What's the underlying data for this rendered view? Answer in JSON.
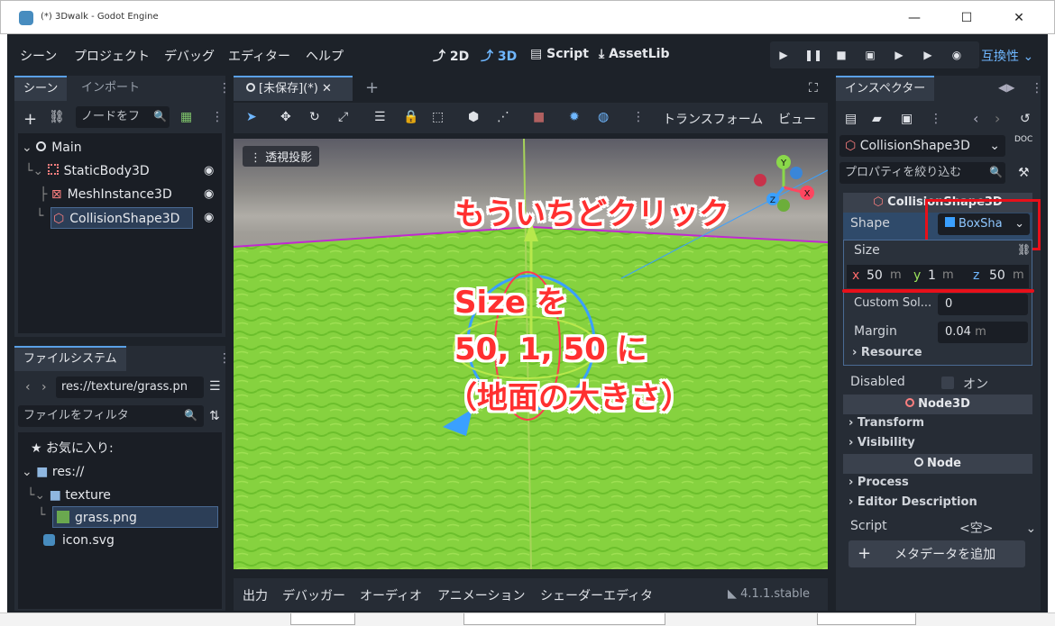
{
  "window": {
    "title": "(*) 3Dwalk - Godot Engine",
    "minimize": "—",
    "maximize": "☐",
    "close": "✕"
  },
  "menu": [
    "シーン",
    "プロジェクト",
    "デバッグ",
    "エディター",
    "ヘルプ"
  ],
  "modes": {
    "m2d": "2D",
    "m3d": "3D",
    "script": "Script",
    "assetlib": "AssetLib"
  },
  "renderer": "互換性",
  "scene_panel": {
    "tabs": [
      "シーン",
      "インポート"
    ],
    "filter_placeholder": "ノードをフ",
    "nodes": [
      "Main",
      "StaticBody3D",
      "MeshInstance3D",
      "CollisionShape3D"
    ]
  },
  "fs_panel": {
    "tab": "ファイルシステム",
    "path": "res://texture/grass.pn",
    "filter_placeholder": "ファイルをフィルタ",
    "items": [
      "お気に入り:",
      "res://",
      "texture",
      "grass.png",
      "icon.svg"
    ]
  },
  "editor": {
    "tab": "[未保存](*)",
    "menu_transform": "トランスフォーム",
    "menu_view": "ビュー",
    "projection": "透視投影"
  },
  "gizmo": {
    "x": "X",
    "y": "Y",
    "z": "Z"
  },
  "bottom_tabs": [
    "出力",
    "デバッガー",
    "オーディオ",
    "アニメーション",
    "シェーダーエディタ"
  ],
  "version": "4.1.1.stable",
  "inspector": {
    "tab": "インスペクター",
    "node": "CollisionShape3D",
    "filter_placeholder": "プロパティを絞り込む",
    "section_title": "CollisionShape3D",
    "shape_label": "Shape",
    "shape_value": "BoxSha",
    "size_label": "Size",
    "size": {
      "x_label": "x",
      "x": "50",
      "y_label": "y",
      "y": "1",
      "z_label": "z",
      "z": "50",
      "unit": "m"
    },
    "custom_label": "Custom Sol...",
    "custom_value": "0",
    "margin_label": "Margin",
    "margin_value": "0.04",
    "resource": "Resource",
    "disabled_label": "Disabled",
    "disabled_value": "オン",
    "sections": [
      "Node3D",
      "Transform",
      "Visibility",
      "Node",
      "Process",
      "Editor Description"
    ],
    "script_label": "Script",
    "script_value": "<空>",
    "add_meta": "メタデータを追加",
    "doc": "DOC"
  },
  "annotations": {
    "click_again": "もういちどクリック",
    "size_line1": "Size を",
    "size_line2": "50, 1, 50 に",
    "size_line3": "（地面の大きさ）"
  },
  "colors": {
    "accent": "#6fb7ff",
    "annotation": "#ff3030",
    "highlight_box": "#e8101a"
  }
}
